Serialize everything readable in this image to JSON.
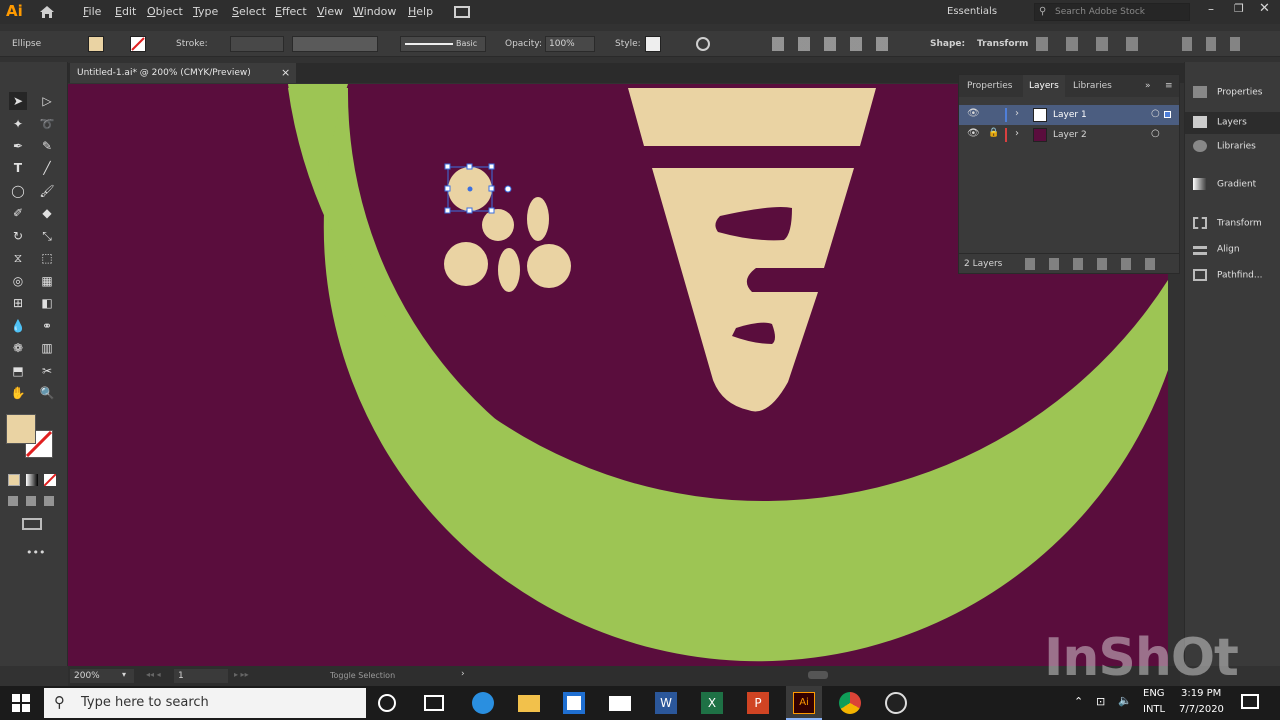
{
  "app": {
    "logo": "Ai",
    "menu": [
      "File",
      "Edit",
      "Object",
      "Type",
      "Select",
      "Effect",
      "View",
      "Window",
      "Help"
    ],
    "workspace": "Essentials",
    "search_placeholder": "Search Adobe Stock"
  },
  "control": {
    "selection_type": "Ellipse",
    "stroke_label": "Stroke:",
    "brush_label": "Basic",
    "opacity_label": "Opacity:",
    "opacity_value": "100%",
    "style_label": "Style:",
    "shape_label": "Shape:",
    "transform_label": "Transform"
  },
  "document": {
    "tab_title": "Untitled-1.ai* @ 200% (CMYK/Preview)",
    "close_symbol": "×"
  },
  "layers_panel": {
    "tabs": [
      "Properties",
      "Layers",
      "Libraries"
    ],
    "layers": [
      {
        "name": "Layer 1",
        "color": "#4f7fd9",
        "selected": true
      },
      {
        "name": "Layer 2",
        "color": "#d94040",
        "selected": false
      }
    ],
    "count_label": "2 Layers"
  },
  "right_dock": [
    "Properties",
    "Layers",
    "Libraries",
    "Gradient",
    "Transform",
    "Align",
    "Pathfind..."
  ],
  "status": {
    "zoom": "200%",
    "artboard": "1",
    "status_text": "Toggle Selection"
  },
  "taskbar": {
    "search_placeholder": "Type here to search",
    "lang_top": "ENG",
    "lang_bottom": "INTL",
    "time": "3:19 PM",
    "date": "7/7/2020"
  },
  "watermark": "InShOt",
  "colors": {
    "canvas": "#5a0d3d",
    "ring": "#9dc554",
    "shape": "#ead3a3",
    "accent": "#ff9a00"
  },
  "icons": [
    "home-icon",
    "selection-tool-icon",
    "pen-tool-icon",
    "type-tool-icon",
    "ellipse-tool-icon",
    "hand-tool-icon",
    "zoom-tool-icon",
    "eye-icon",
    "lock-icon",
    "windows-logo-icon",
    "search-icon",
    "edge-icon",
    "explorer-icon",
    "store-icon",
    "mail-icon",
    "word-icon",
    "excel-icon",
    "powerpoint-icon",
    "illustrator-icon",
    "chrome-icon",
    "obs-icon"
  ]
}
